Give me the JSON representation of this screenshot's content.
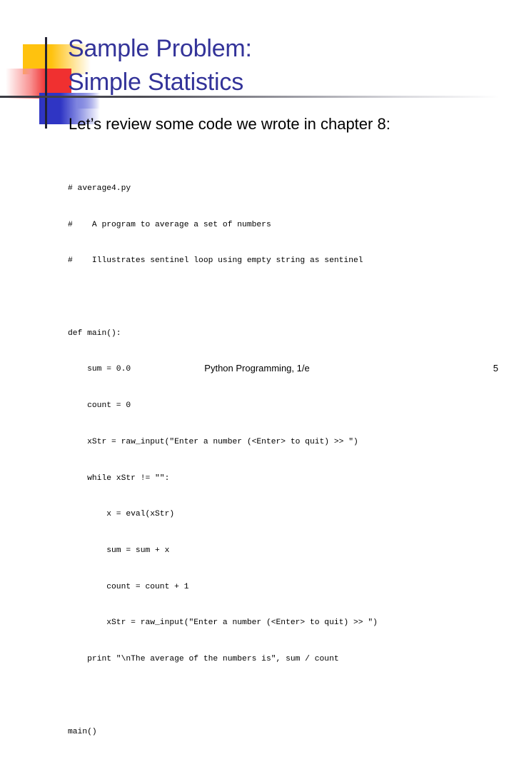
{
  "slide": {
    "title_lines": [
      "Sample Problem:",
      "Simple Statistics"
    ],
    "subtitle": "Let’s review some code we wrote in chapter 8:",
    "code_lines": [
      "# average4.py",
      "#    A program to average a set of numbers",
      "#    Illustrates sentinel loop using empty string as sentinel",
      "",
      "def main():",
      "    sum = 0.0",
      "    count = 0",
      "    xStr = raw_input(\"Enter a number (<Enter> to quit) >> \")",
      "    while xStr != \"\":",
      "        x = eval(xStr)",
      "        sum = sum + x",
      "        count = count + 1",
      "        xStr = raw_input(\"Enter a number (<Enter> to quit) >> \")",
      "    print \"\\nThe average of the numbers is\", sum / count",
      "",
      "main()"
    ],
    "footer": {
      "text": "Python Programming, 1/e",
      "page_number": "5"
    },
    "colors": {
      "title": "#333399",
      "body": "#000000",
      "accent_yellow": "#FFC20E",
      "accent_red": "#F03030",
      "accent_blue": "#2F35C4",
      "rule": "#3a3a42",
      "background": "#FFFFFF"
    }
  }
}
